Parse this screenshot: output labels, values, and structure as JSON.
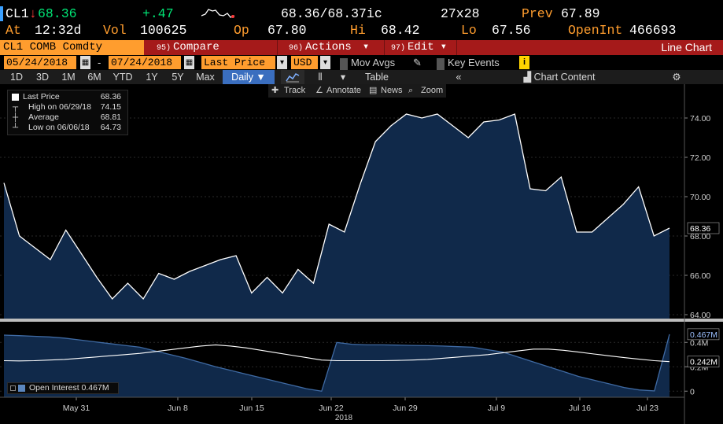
{
  "quote": {
    "ticker": "CL1",
    "arrow": "↓",
    "last": "68.36",
    "change": "+.47",
    "bid_ask": "68.36/68.37ic",
    "size": "27x28",
    "prev_label": "Prev",
    "prev": "67.89",
    "at_label": "At",
    "time": "12:32d",
    "vol_label": "Vol",
    "vol": "100625",
    "op_label": "Op",
    "open": "67.80",
    "hi_label": "Hi",
    "high": "68.42",
    "lo_label": "Lo",
    "low": "67.56",
    "oi_label": "OpenInt",
    "open_interest": "466693"
  },
  "command_bar": {
    "security": "CL1 COMB Comdty",
    "compare_num": "95)",
    "compare": "Compare",
    "actions_num": "96)",
    "actions": "Actions",
    "edit_num": "97)",
    "edit": "Edit",
    "title": "Line Chart"
  },
  "date_row": {
    "start": "05/24/2018",
    "end": "07/24/2018",
    "dash": "-",
    "field": "Last Price",
    "currency": "USD",
    "mov_avgs": "Mov Avgs",
    "key_events": "Key Events",
    "info": "i"
  },
  "tabs": {
    "periods": [
      "1D",
      "3D",
      "1M",
      "6M",
      "YTD",
      "1Y",
      "5Y",
      "Max"
    ],
    "frequency": "Daily ▼",
    "table": "Table",
    "collapse": "«",
    "chart_content": "Chart Content",
    "settings_icon": "⚙"
  },
  "toolbar": {
    "track": "Track",
    "annotate": "Annotate",
    "news": "News",
    "zoom": "Zoom"
  },
  "legend": {
    "title": "Last Price",
    "title_value": "68.36",
    "high_label": "High on 06/29/18",
    "high_value": "74.15",
    "avg_label": "Average",
    "avg_value": "68.81",
    "low_label": "Low on 06/06/18",
    "low_value": "64.73"
  },
  "oi_legend": "Open Interest 0.467M",
  "colors": {
    "accent_orange": "#ff9d2e",
    "cmd_bar_red": "#a51a1a",
    "area_fill": "#0f2a4a",
    "price_line": "#ffffff",
    "tab_active": "#3a6ebf"
  },
  "chart_data": {
    "type": "area",
    "x_axis_labels": [
      "May 31",
      "Jun 8",
      "Jun 15",
      "Jun 22",
      "Jun 29",
      "Jul 9",
      "Jul 16",
      "Jul 23"
    ],
    "year_label": "2018",
    "price_panel": {
      "series_name": "Last Price",
      "yticks": [
        "64.00",
        "66.00",
        "68.00",
        "70.00",
        "72.00",
        "74.00"
      ],
      "ylim": [
        63.8,
        75.0
      ],
      "last_label": "68.36",
      "values": [
        70.7,
        68.0,
        67.4,
        66.8,
        68.3,
        67.1,
        65.9,
        64.8,
        65.6,
        64.8,
        66.1,
        65.8,
        66.2,
        66.5,
        66.8,
        67.0,
        65.1,
        65.9,
        65.1,
        66.3,
        65.6,
        68.6,
        68.2,
        70.6,
        72.8,
        73.6,
        74.2,
        74.0,
        74.2,
        73.6,
        73.0,
        73.8,
        73.9,
        74.2,
        70.4,
        70.3,
        71.0,
        68.2,
        68.2,
        68.9,
        69.6,
        70.5,
        68.0,
        68.4
      ]
    },
    "oi_panel": {
      "series_name": "Open Interest",
      "yticks": [
        "0",
        "0.2M",
        "0.4M"
      ],
      "ylim": [
        -0.05,
        0.55
      ],
      "last_label": "0.467M",
      "secondary_label": "0.242M",
      "values": [
        0.46,
        0.455,
        0.45,
        0.445,
        0.435,
        0.42,
        0.405,
        0.39,
        0.375,
        0.36,
        0.33,
        0.3,
        0.27,
        0.235,
        0.2,
        0.17,
        0.14,
        0.11,
        0.08,
        0.05,
        0.02,
        0.0,
        0.4,
        0.385,
        0.38,
        0.38,
        0.378,
        0.375,
        0.373,
        0.37,
        0.365,
        0.36,
        0.34,
        0.32,
        0.28,
        0.24,
        0.2,
        0.16,
        0.12,
        0.09,
        0.06,
        0.03,
        0.01,
        0.002,
        0.467
      ],
      "secondary_values": [
        0.25,
        0.248,
        0.25,
        0.255,
        0.26,
        0.27,
        0.28,
        0.29,
        0.3,
        0.31,
        0.325,
        0.34,
        0.355,
        0.37,
        0.38,
        0.37,
        0.355,
        0.335,
        0.315,
        0.295,
        0.275,
        0.255,
        0.25,
        0.25,
        0.25,
        0.25,
        0.252,
        0.255,
        0.26,
        0.27,
        0.28,
        0.29,
        0.3,
        0.315,
        0.33,
        0.345,
        0.345,
        0.335,
        0.32,
        0.305,
        0.29,
        0.275,
        0.262,
        0.25,
        0.242
      ]
    }
  }
}
